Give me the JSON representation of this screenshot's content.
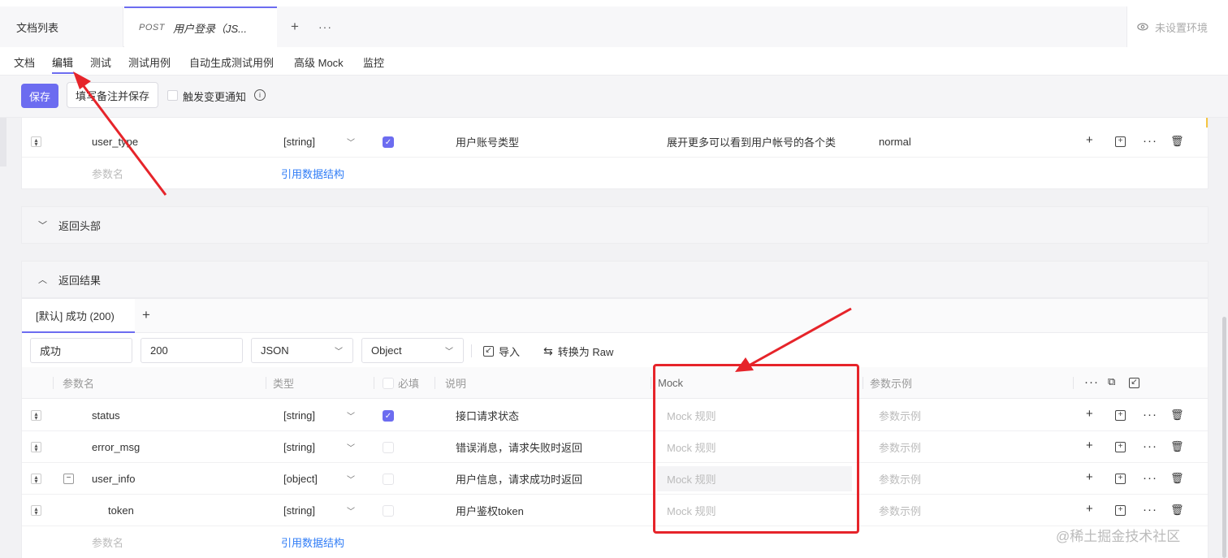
{
  "top_tabs": {
    "doc_list": "文档列表",
    "active_method": "POST",
    "active_title": "用户登录（JS...",
    "plus": "+",
    "more": "···",
    "env_label": "未设置环境"
  },
  "sub_tabs": [
    "文档",
    "编辑",
    "测试",
    "测试用例",
    "自动生成测试用例",
    "高级 Mock",
    "监控"
  ],
  "actions": {
    "save": "保存",
    "note_save": "填写备注并保存",
    "notify": "触发变更通知",
    "info": "i"
  },
  "upper_table": {
    "row": {
      "name": "user_type",
      "type": "[string]",
      "required": true,
      "desc": "用户账号类型",
      "mock": "展开更多可以看到用户帐号的各个类",
      "example": "normal"
    },
    "empty_row": {
      "name_placeholder": "参数名",
      "ref_link": "引用数据结构"
    }
  },
  "sections": {
    "response_headers": "返回头部",
    "response_body": "返回结果"
  },
  "response_tab": {
    "label": "[默认] 成功 (200)",
    "add": "+"
  },
  "response_config": {
    "name": "成功",
    "code": "200",
    "format": "JSON",
    "root_type": "Object",
    "import_label": "导入",
    "convert_label": "转换为 Raw"
  },
  "columns": {
    "name": "参数名",
    "type": "类型",
    "required": "必填",
    "desc": "说明",
    "mock": "Mock",
    "example": "参数示例"
  },
  "rows": [
    {
      "name": "status",
      "type": "[string]",
      "required": true,
      "desc": "接口请求状态",
      "mock": "Mock 规则",
      "example": "参数示例"
    },
    {
      "name": "error_msg",
      "type": "[string]",
      "required": false,
      "desc": "错误消息，请求失败时返回",
      "mock": "Mock 规则",
      "example": "参数示例"
    },
    {
      "name": "user_info",
      "type": "[object]",
      "required": false,
      "desc": "用户信息，请求成功时返回",
      "mock": "Mock 规则",
      "example": "参数示例"
    },
    {
      "name": "token",
      "type": "[string]",
      "required": false,
      "desc": "用户鉴权token",
      "mock": "Mock 规则",
      "example": "参数示例"
    }
  ],
  "lower_empty_row": {
    "name_placeholder": "参数名",
    "ref_link": "引用数据结构"
  },
  "watermark": "@稀土掘金技术社区",
  "colors": {
    "accent": "#6c6cf0",
    "link": "#2f7cf6",
    "annotation": "#e6242a"
  }
}
